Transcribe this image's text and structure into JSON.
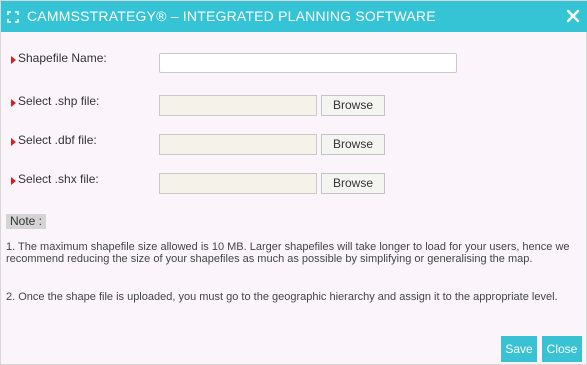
{
  "window": {
    "title": "CAMMSSTRATEGY® – INTEGRATED PLANNING SOFTWARE",
    "title_icon": "expand-icon",
    "close_icon": "close-icon"
  },
  "form": {
    "shapefile_name": {
      "label": "Shapefile Name:",
      "value": ""
    },
    "shp_file": {
      "label": "Select .shp file:",
      "value": "",
      "button": "Browse"
    },
    "dbf_file": {
      "label": "Select .dbf file:",
      "value": "",
      "button": "Browse"
    },
    "shx_file": {
      "label": "Select .shx file:",
      "value": "",
      "button": "Browse"
    }
  },
  "note": {
    "title": "Note :",
    "items": [
      "1. The maximum shapefile size allowed is 10 MB. Larger shapefiles will take longer to load for your users, hence we recommend reducing the size of your shapefiles as much as possible by simplifying or generalising the map.",
      "2. Once the shape file is uploaded, you must go to the geographic hierarchy and assign it to the appropriate level."
    ]
  },
  "actions": {
    "save": "Save",
    "close": "Close"
  },
  "colors": {
    "accent": "#35c4d6",
    "required_marker": "#d0211c",
    "background": "#fbf5fb"
  }
}
